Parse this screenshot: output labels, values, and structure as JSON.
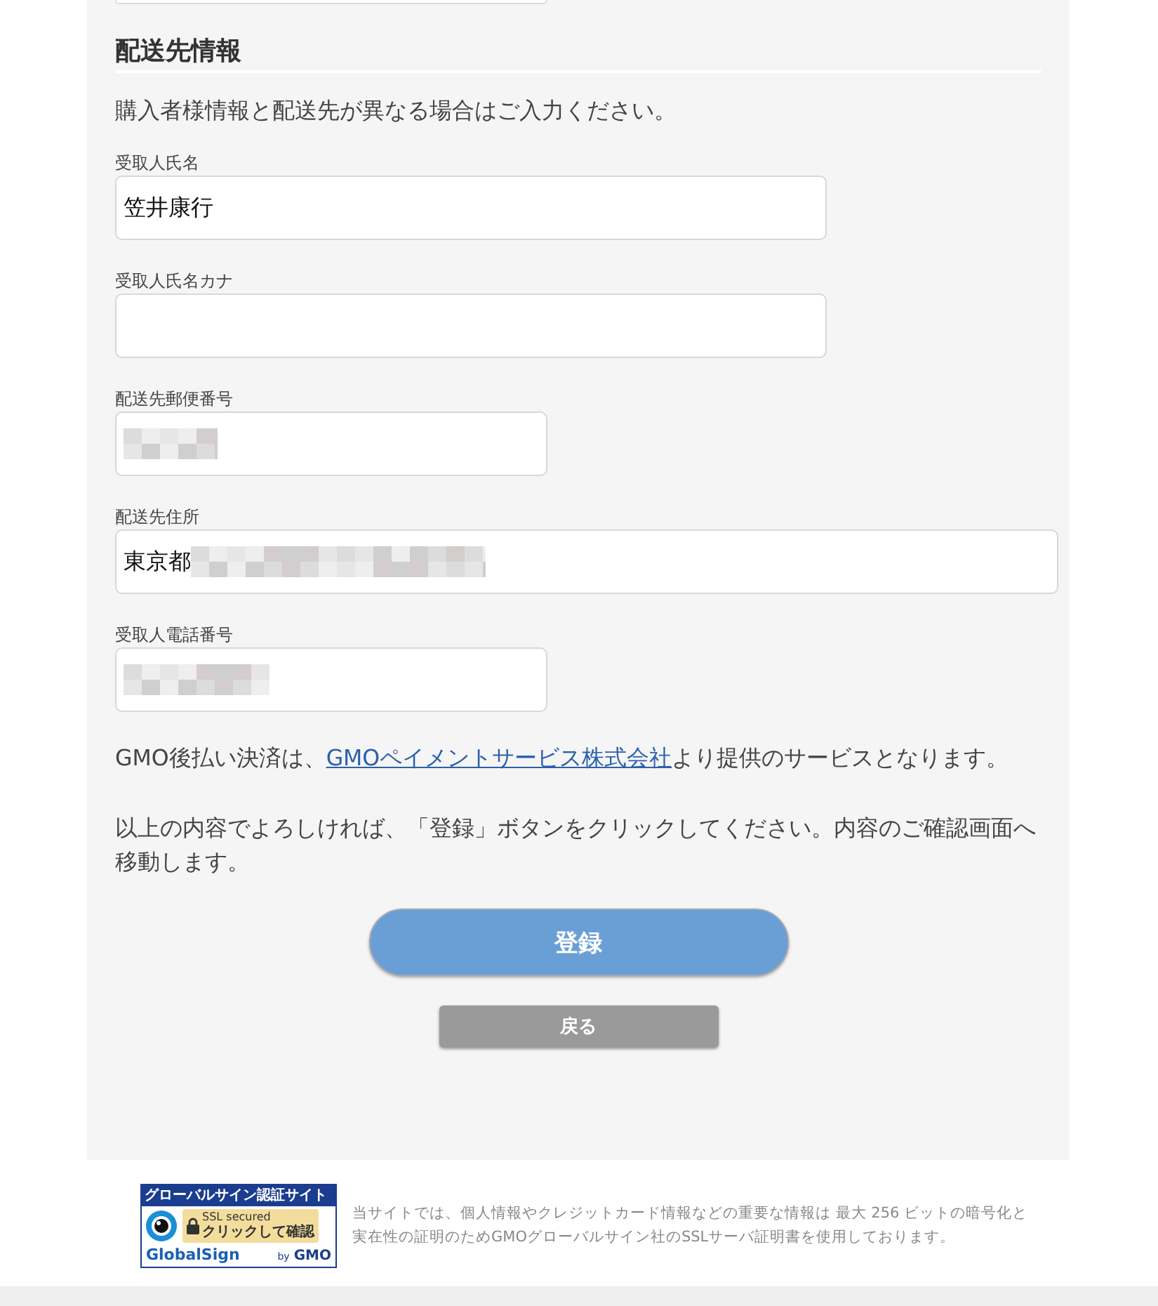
{
  "above": [
    {
      "kind": "input"
    }
  ],
  "section": {
    "heading": "配送先情報",
    "description": "購入者様情報と配送先が異なる場合はご入力ください。",
    "fields": [
      {
        "kind": "name",
        "label": "受取人氏名",
        "value": "笠井康行",
        "redacted": false
      },
      {
        "kind": "kana",
        "label": "受取人氏名カナ",
        "redacted": false
      },
      {
        "kind": "postal",
        "label": "配送先郵便番号",
        "redacted": true
      },
      {
        "kind": "address",
        "label": "配送先住所",
        "value": "東京都",
        "redacted": true
      },
      {
        "kind": "phone",
        "label": "受取人電話番号",
        "redacted": true
      }
    ]
  },
  "notice": {
    "before": "GMO後払い決済は、",
    "link": "GMOペイメントサービス株式会社",
    "after": "より提供のサービスとなります。"
  },
  "instruction": "以上の内容でよろしければ、「登録」ボタンをクリックしてください。内容のご確認画面へ移動します。",
  "buttons": [
    {
      "kind": "primary",
      "label": "登録"
    },
    {
      "kind": "secondary",
      "label": "戻る"
    }
  ],
  "footer": {
    "badge": {
      "title": "グローバルサイン認証サイト",
      "ssl": "SSL secured",
      "action": "クリックして確認",
      "brand": "GlobalSign",
      "by": "by",
      "maker": "GMO"
    },
    "notice_lines": [
      "当サイトでは、個人情報やクレジットカード情報などの重要な情報は 最大 256 ビットの暗号化と",
      "実在性の証明のためGMOグローバルサイン社のSSLサーバ証明書を使用しております。"
    ]
  }
}
